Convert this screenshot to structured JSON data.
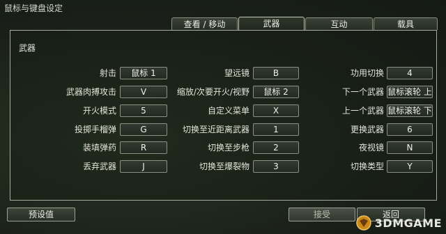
{
  "window": {
    "title": "鼠标与键盘设定"
  },
  "tabs": [
    {
      "label": "查看 / 移动",
      "active": false
    },
    {
      "label": "武器",
      "active": true
    },
    {
      "label": "互动",
      "active": false
    },
    {
      "label": "载具",
      "active": false
    }
  ],
  "panel": {
    "title": "武器"
  },
  "bindings": {
    "col1": [
      {
        "action": "射击",
        "key": "鼠标 1"
      },
      {
        "action": "武器肉搏攻击",
        "key": "V"
      },
      {
        "action": "开火模式",
        "key": "5"
      },
      {
        "action": "投掷手榴弹",
        "key": "G"
      },
      {
        "action": "装填弹药",
        "key": "R"
      },
      {
        "action": "丢弃武器",
        "key": "J"
      }
    ],
    "col2": [
      {
        "action": "望远镜",
        "key": "B"
      },
      {
        "action": "缩放/次要开火/视野",
        "key": "鼠标 2"
      },
      {
        "action": "自定义菜单",
        "key": "X"
      },
      {
        "action": "切换至近距离武器",
        "key": "1"
      },
      {
        "action": "切换至步枪",
        "key": "2"
      },
      {
        "action": "切换至爆裂物",
        "key": "3"
      }
    ],
    "col3": [
      {
        "action": "功用切换",
        "key": "4"
      },
      {
        "action": "下一个武器",
        "key": "鼠标滚轮 上"
      },
      {
        "action": "上一个武器",
        "key": "鼠标滚轮 下"
      },
      {
        "action": "更换武器",
        "key": "6"
      },
      {
        "action": "夜视镜",
        "key": "N"
      },
      {
        "action": "切换类型",
        "key": "Y"
      }
    ]
  },
  "footer": {
    "preset_label": "预设值",
    "accept_label": "接受",
    "back_label": "返回"
  },
  "watermark": {
    "text": "3DMGAME"
  }
}
